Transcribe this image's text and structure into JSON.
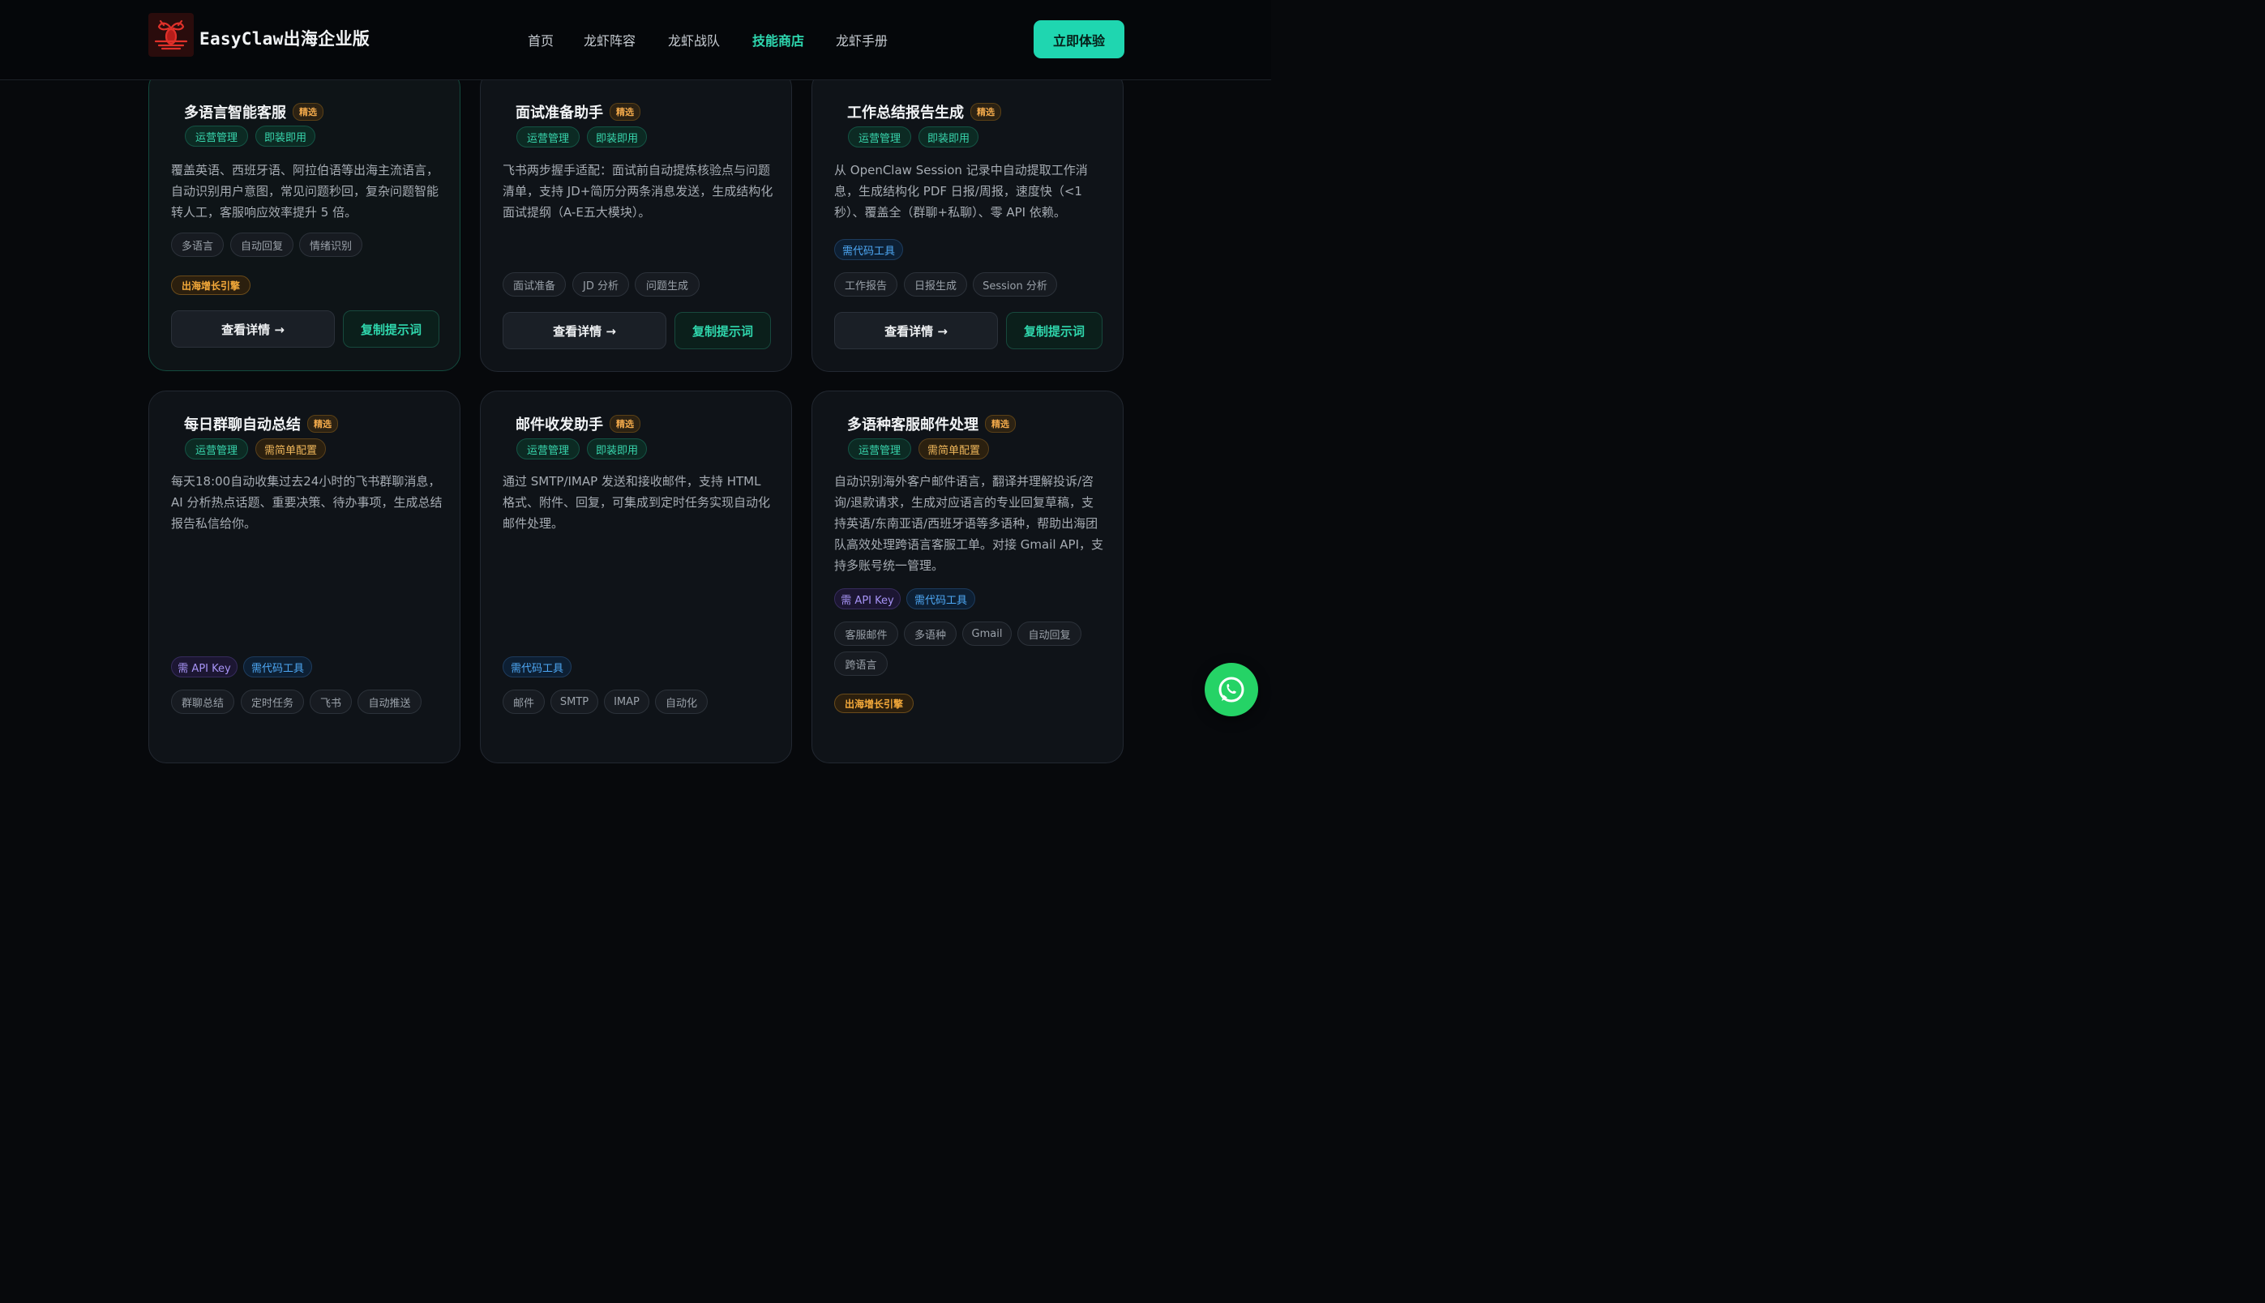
{
  "brand": {
    "name_en": "EasyClaw",
    "name_cn": "出海企业版"
  },
  "nav": {
    "items": [
      "首页",
      "龙虾阵容",
      "龙虾战队",
      "技能商店",
      "龙虾手册"
    ],
    "active": "技能商店",
    "cta": "立即体验"
  },
  "common": {
    "featured": "精选",
    "detail_btn": "查看详情 →",
    "copy_btn": "复制提示词",
    "growth": "出海增长引擎"
  },
  "cards": [
    {
      "title": "多语言智能客服",
      "categories": [
        "运营管理",
        "即装即用"
      ],
      "desc": "覆盖英语、西班牙语、阿拉伯语等出海主流语言，自动识别用户意图，常见问题秒回，复杂问题智能转人工，客服响应效率提升 5 倍。",
      "requirements": [],
      "tags": [
        "多语言",
        "自动回复",
        "情绪识别"
      ]
    },
    {
      "title": "面试准备助手",
      "categories": [
        "运营管理",
        "即装即用"
      ],
      "desc": "飞书两步握手适配：面试前自动提炼核验点与问题清单，支持 JD+简历分两条消息发送，生成结构化面试提纲（A-E五大模块）。",
      "requirements": [],
      "tags": [
        "面试准备",
        "JD 分析",
        "问题生成"
      ]
    },
    {
      "title": "工作总结报告生成",
      "categories": [
        "运营管理",
        "即装即用"
      ],
      "desc": "从 OpenClaw Session 记录中自动提取工作消息，生成结构化 PDF 日报/周报，速度快（<1秒）、覆盖全（群聊+私聊）、零 API 依赖。",
      "requirements": [
        "需代码工具"
      ],
      "tags": [
        "工作报告",
        "日报生成",
        "Session 分析"
      ]
    },
    {
      "title": "每日群聊自动总结",
      "categories": [
        "运营管理",
        "需简单配置"
      ],
      "desc": "每天18:00自动收集过去24小时的飞书群聊消息，AI 分析热点话题、重要决策、待办事项，生成总结报告私信给你。",
      "requirements": [
        "需 API Key",
        "需代码工具"
      ],
      "tags": [
        "群聊总结",
        "定时任务",
        "飞书",
        "自动推送"
      ]
    },
    {
      "title": "邮件收发助手",
      "categories": [
        "运营管理",
        "即装即用"
      ],
      "desc": "通过 SMTP/IMAP 发送和接收邮件，支持 HTML 格式、附件、回复，可集成到定时任务实现自动化邮件处理。",
      "requirements": [
        "需代码工具"
      ],
      "tags": [
        "邮件",
        "SMTP",
        "IMAP",
        "自动化"
      ]
    },
    {
      "title": "多语种客服邮件处理",
      "categories": [
        "运营管理",
        "需简单配置"
      ],
      "desc": "自动识别海外客户邮件语言，翻译并理解投诉/咨询/退款请求，生成对应语言的专业回复草稿，支持英语/东南亚语/西班牙语等多语种，帮助出海团队高效处理跨语言客服工单。对接 Gmail API，支持多账号统一管理。",
      "requirements": [
        "需 API Key",
        "需代码工具"
      ],
      "tags": [
        "客服邮件",
        "多语种",
        "Gmail",
        "自动回复",
        "跨语言"
      ]
    }
  ]
}
